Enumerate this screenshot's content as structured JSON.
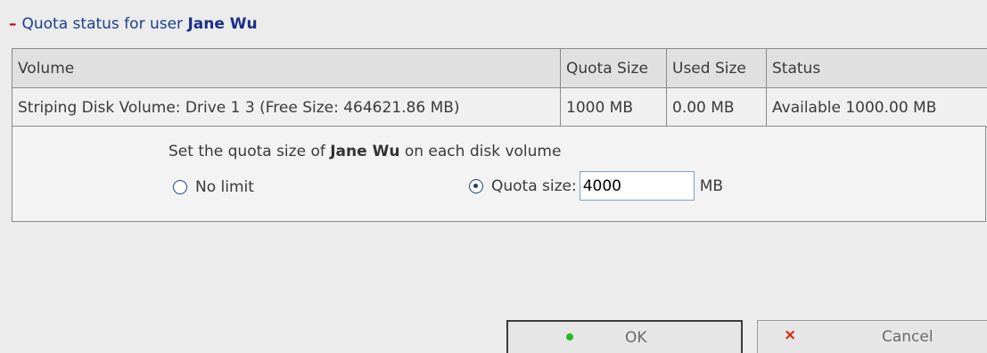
{
  "header": {
    "toggle": "–",
    "title_prefix": "Quota status for user",
    "user": "Jane Wu"
  },
  "table": {
    "columns": [
      "Volume",
      "Quota Size",
      "Used Size",
      "Status"
    ],
    "rows": [
      [
        "Striping Disk Volume: Drive 1 3 (Free Size: 464621.86 MB)",
        "1000 MB",
        "0.00 MB",
        "Available 1000.00 MB"
      ]
    ]
  },
  "settings": {
    "prompt_before": "Set the quota size of",
    "user": "Jane Wu",
    "prompt_after": "on each disk volume",
    "no_limit_label": "No limit",
    "quota_size_label": "Quota size:",
    "quota_value": "4000",
    "unit": "MB",
    "selected_option": "quota_size"
  },
  "buttons": {
    "ok_label": "OK",
    "cancel_label": "Cancel"
  },
  "colors": {
    "accent": "#1a3e8c",
    "ok_indicator": "#22bb22",
    "cancel_indicator": "#dd2200"
  }
}
